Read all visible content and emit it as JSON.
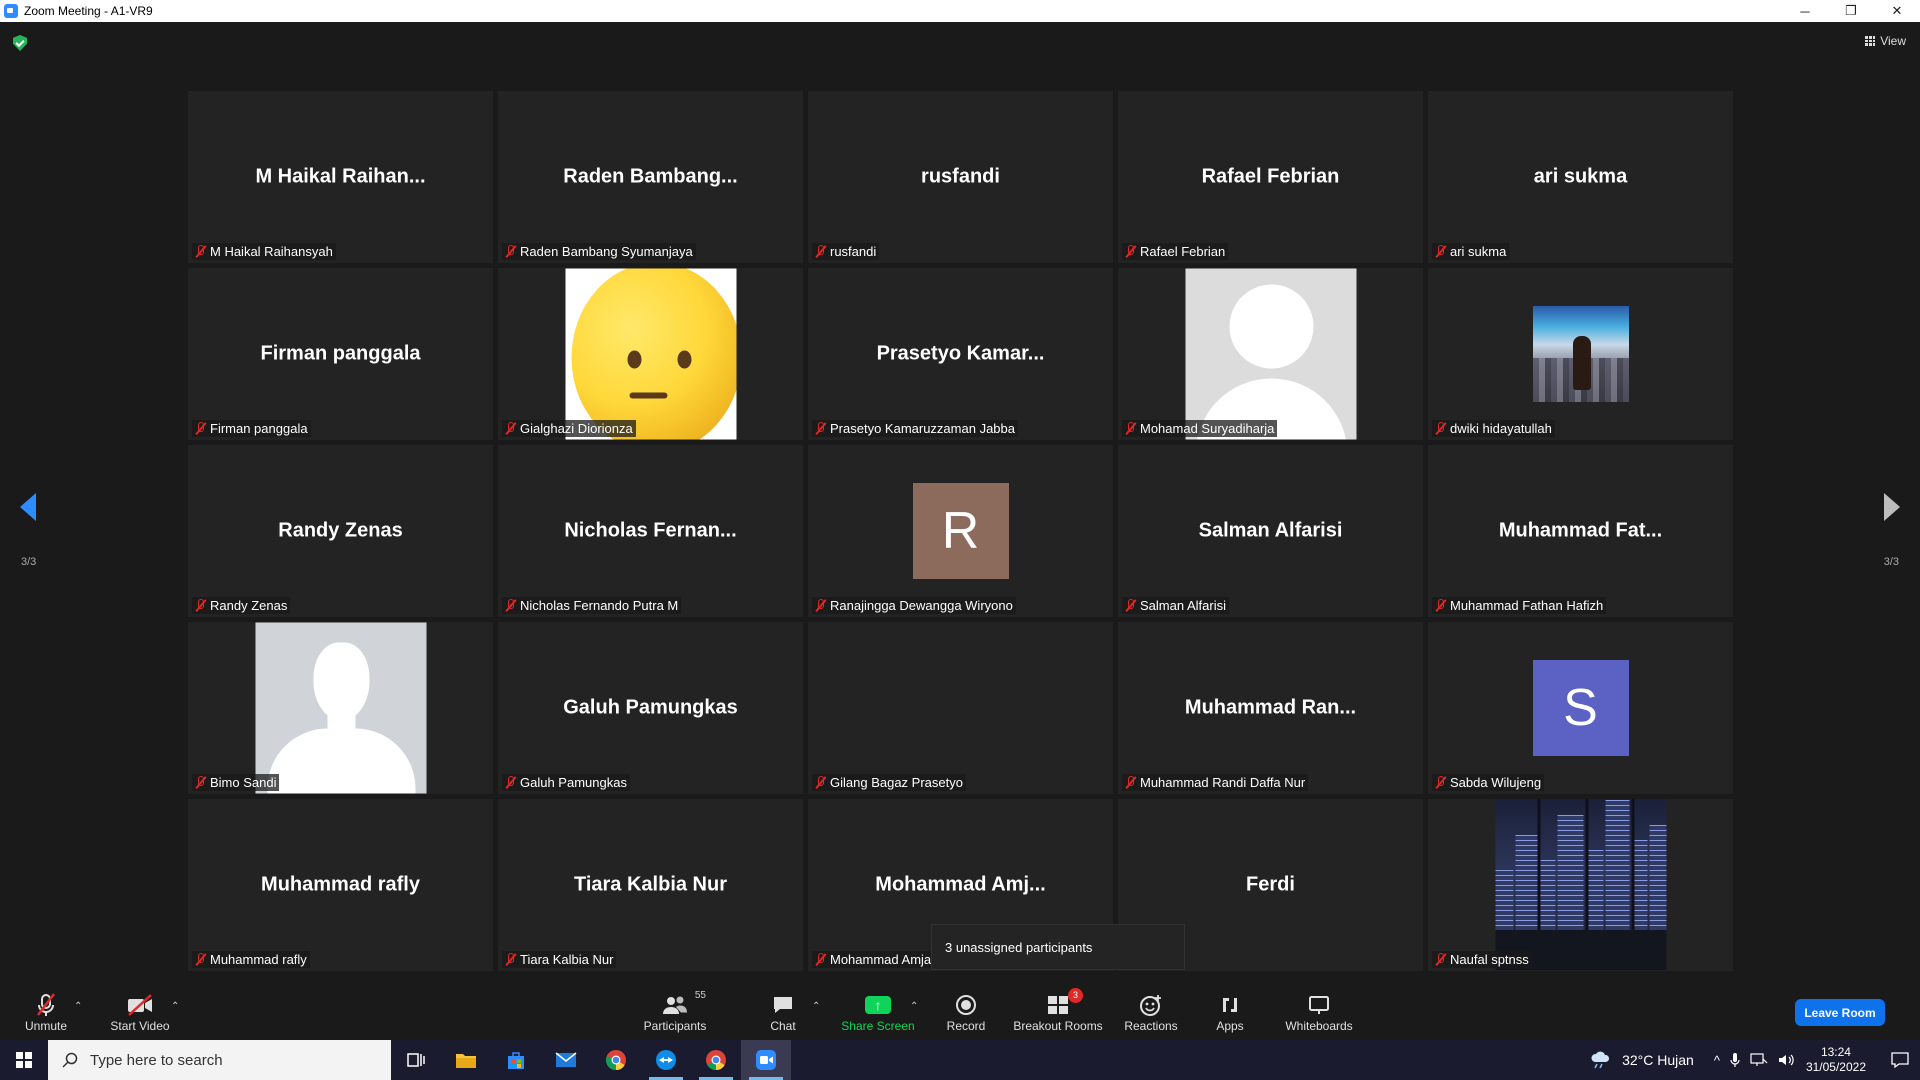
{
  "window": {
    "title": "Zoom Meeting - A1-VR9",
    "minimize": "─",
    "maximize": "❐",
    "close": "✕"
  },
  "meeting": {
    "view_label": "View",
    "page_indicator_left": "3/3",
    "page_indicator_right": "3/3",
    "tooltip": "3 unassigned participants"
  },
  "tiles": [
    {
      "display": "M  Haikal  Raihan...",
      "name": "M Haikal Raihansyah"
    },
    {
      "display": "Raden  Bambang...",
      "name": "Raden Bambang Syumanjaya"
    },
    {
      "display": "rusfandi",
      "name": "rusfandi"
    },
    {
      "display": "Rafael Febrian",
      "name": "Rafael Febrian"
    },
    {
      "display": "ari sukma",
      "name": "ari sukma"
    },
    {
      "display": "Firman panggala",
      "name": "Firman panggala"
    },
    {
      "display": "",
      "name": "Gialghazi Diorionza",
      "picture": "emoji-face"
    },
    {
      "display": "Prasetyo  Kamar...",
      "name": "Prasetyo Kamaruzzaman Jabba"
    },
    {
      "display": "",
      "name": "Mohamad Suryadiharja",
      "picture": "default-avatar"
    },
    {
      "display": "",
      "name": "dwiki hidayatullah",
      "picture": "photo"
    },
    {
      "display": "Randy Zenas",
      "name": "Randy Zenas"
    },
    {
      "display": "Nicholas  Fernan...",
      "name": "Nicholas Fernando Putra M"
    },
    {
      "display": "",
      "name": "Ranajingga Dewangga Wiryono",
      "picture": "letter",
      "letter": "R",
      "color": "#8c6b5d"
    },
    {
      "display": "Salman Alfarisi",
      "name": "Salman Alfarisi"
    },
    {
      "display": "Muhammad  Fat...",
      "name": "Muhammad Fathan Hafizh"
    },
    {
      "display": "",
      "name": "Bimo Sandi",
      "picture": "silhouette"
    },
    {
      "display": "Galuh Pamungkas",
      "name": "Galuh Pamungkas"
    },
    {
      "display": "",
      "name": "Gilang Bagaz Prasetyo"
    },
    {
      "display": "Muhammad  Ran...",
      "name": "Muhammad Randi Daffa Nur"
    },
    {
      "display": "",
      "name": "Sabda Wilujeng",
      "picture": "letter",
      "letter": "S",
      "color": "#5b62c4"
    },
    {
      "display": "Muhammad rafly",
      "name": "Muhammad rafly"
    },
    {
      "display": "Tiara Kalbia Nur",
      "name": "Tiara Kalbia Nur"
    },
    {
      "display": "Mohammad  Amj...",
      "name": "Mohammad Amja"
    },
    {
      "display": "Ferdi",
      "name": "Ferdi"
    },
    {
      "display": "",
      "name": "Naufal sptnss",
      "picture": "city"
    }
  ],
  "toolbar": {
    "unmute": "Unmute",
    "start_video": "Start Video",
    "participants": "Participants",
    "participants_count": "55",
    "chat": "Chat",
    "share_screen": "Share Screen",
    "record": "Record",
    "breakout_rooms": "Breakout Rooms",
    "breakout_badge": "3",
    "reactions": "Reactions",
    "apps": "Apps",
    "whiteboards": "Whiteboards",
    "leave": "Leave Room"
  },
  "taskbar": {
    "search_placeholder": "Type here to search",
    "weather": "32°C  Hujan",
    "time": "13:24",
    "date": "31/05/2022"
  },
  "colors": {
    "accent_blue": "#2d8cff",
    "share_green": "#0fd45a",
    "mute_red": "#e02828",
    "leave_blue": "#0e72ed"
  }
}
